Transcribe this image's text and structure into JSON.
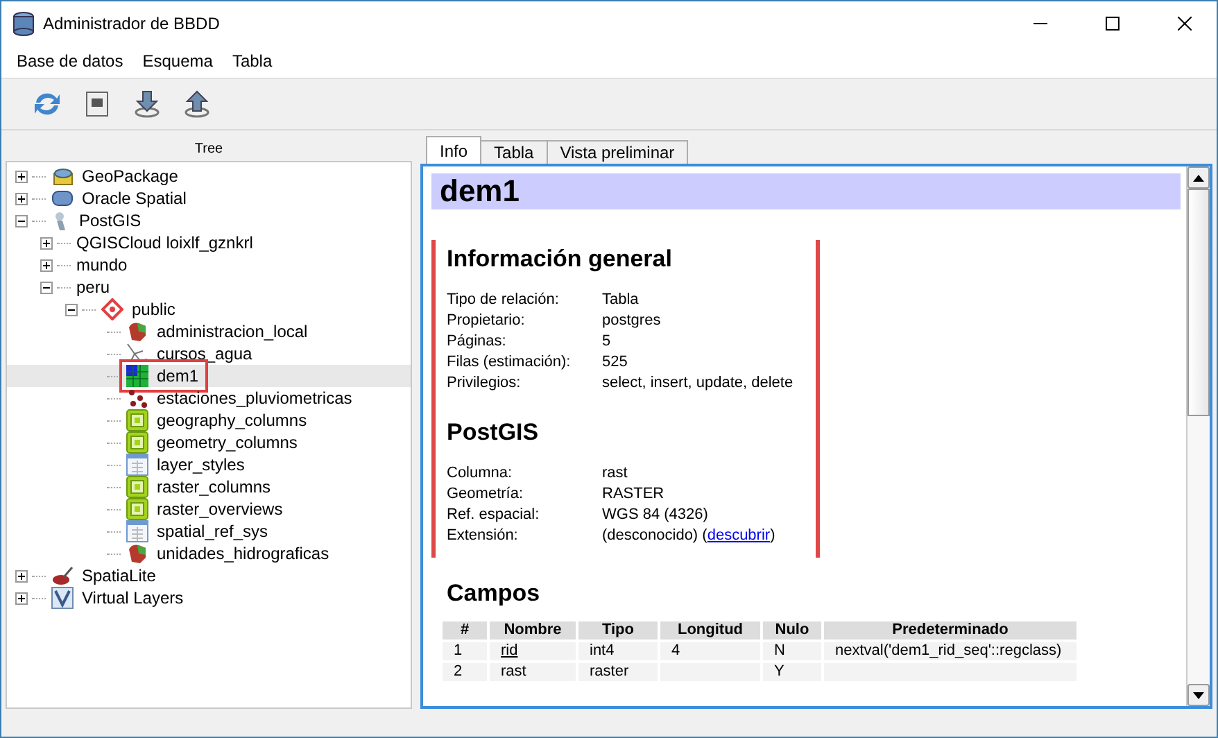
{
  "window": {
    "title": "Administrador de BBDD"
  },
  "menu": [
    "Base de datos",
    "Esquema",
    "Tabla"
  ],
  "toolbar": [
    {
      "kind": "refresh"
    },
    {
      "kind": "sql"
    },
    {
      "kind": "import"
    },
    {
      "kind": "export"
    }
  ],
  "tree_header": "Tree",
  "tree": [
    {
      "label": "GeoPackage",
      "kind": "geopackage",
      "expanded": false,
      "selected": false,
      "highlighted": false
    },
    {
      "label": "Oracle Spatial",
      "kind": "oracle",
      "expanded": false,
      "selected": false,
      "highlighted": false
    },
    {
      "label": "PostGIS",
      "kind": "postgis",
      "expanded": true,
      "selected": false,
      "highlighted": false,
      "children": [
        {
          "label": "QGISCloud loixlf_gznkrl",
          "expanded": false,
          "selected": false,
          "highlighted": false
        },
        {
          "label": "mundo",
          "expanded": false,
          "selected": false,
          "highlighted": false
        },
        {
          "label": "peru",
          "expanded": true,
          "selected": false,
          "highlighted": false,
          "children": [
            {
              "label": "public",
              "kind": "schema",
              "expanded": true,
              "selected": false,
              "highlighted": false,
              "children": [
                {
                  "label": "administracion_local",
                  "kind": "polygon",
                  "selected": false,
                  "highlighted": false
                },
                {
                  "label": "cursos_agua",
                  "kind": "line",
                  "selected": false,
                  "highlighted": false
                },
                {
                  "label": "dem1",
                  "kind": "raster",
                  "selected": true,
                  "highlighted": true
                },
                {
                  "label": "estaciones_pluviometricas",
                  "kind": "point",
                  "selected": false,
                  "highlighted": false
                },
                {
                  "label": "geography_columns",
                  "kind": "view",
                  "selected": false,
                  "highlighted": false
                },
                {
                  "label": "geometry_columns",
                  "kind": "view",
                  "selected": false,
                  "highlighted": false
                },
                {
                  "label": "layer_styles",
                  "kind": "table",
                  "selected": false,
                  "highlighted": false
                },
                {
                  "label": "raster_columns",
                  "kind": "view",
                  "selected": false,
                  "highlighted": false
                },
                {
                  "label": "raster_overviews",
                  "kind": "view",
                  "selected": false,
                  "highlighted": false
                },
                {
                  "label": "spatial_ref_sys",
                  "kind": "table",
                  "selected": false,
                  "highlighted": false
                },
                {
                  "label": "unidades_hidrograficas",
                  "kind": "polygon",
                  "selected": false,
                  "highlighted": false
                }
              ]
            }
          ]
        }
      ]
    },
    {
      "label": "SpatiaLite",
      "kind": "spatialite",
      "expanded": false,
      "selected": false,
      "highlighted": false
    },
    {
      "label": "Virtual Layers",
      "kind": "virtual",
      "expanded": false,
      "selected": false,
      "highlighted": false
    }
  ],
  "tabs": [
    {
      "label": "Info",
      "selected": true
    },
    {
      "label": "Tabla",
      "selected": false
    },
    {
      "label": "Vista preliminar",
      "selected": false
    }
  ],
  "info": {
    "title": "dem1",
    "sections": [
      {
        "heading": "Información general",
        "highlighted": true,
        "rows": [
          {
            "label": "Tipo de relación:",
            "value": "Tabla"
          },
          {
            "label": "Propietario:",
            "value": "postgres"
          },
          {
            "label": "Páginas:",
            "value": "5"
          },
          {
            "label": "Filas (estimación):",
            "value": "525"
          },
          {
            "label": "Privilegios:",
            "value": "select, insert, update, delete"
          }
        ]
      },
      {
        "heading": "PostGIS",
        "highlighted": true,
        "rows": [
          {
            "label": "Columna:",
            "value": "rast"
          },
          {
            "label": "Geometría:",
            "value": "RASTER"
          },
          {
            "label": "Ref. espacial:",
            "value": "WGS 84 (4326)"
          },
          {
            "label": "Extensión:",
            "value": "(desconocido) (",
            "link": "descubrir",
            "after": ")"
          }
        ]
      }
    ],
    "fields": {
      "heading": "Campos",
      "columns": [
        "#",
        "Nombre",
        "Tipo",
        "Longitud",
        "Nulo",
        "Predeterminado"
      ],
      "rows": [
        {
          "cells": [
            "1",
            "rid",
            "int4",
            "4",
            "N",
            "nextval('dem1_rid_seq'::regclass)"
          ],
          "primary_key": true
        },
        {
          "cells": [
            "2",
            "rast",
            "raster",
            "",
            "Y",
            ""
          ],
          "primary_key": false
        }
      ]
    }
  }
}
